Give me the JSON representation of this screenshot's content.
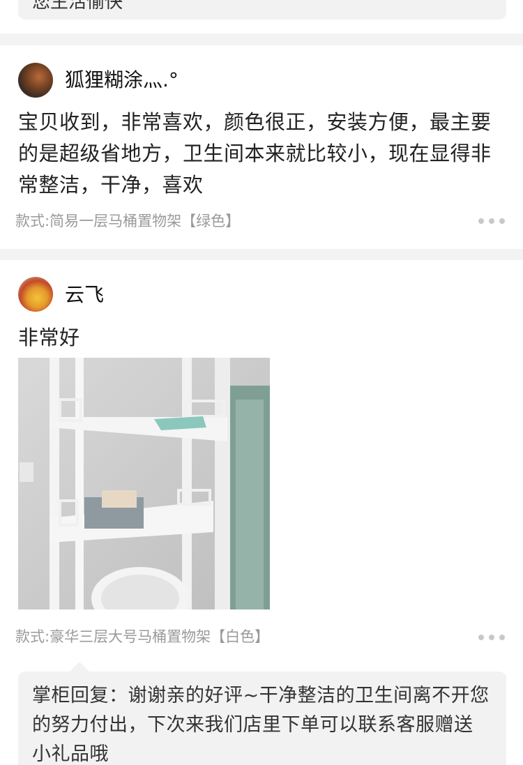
{
  "previous_reply": {
    "text": "您生活愉快"
  },
  "reviews": [
    {
      "username": "狐狸糊涂灬.°",
      "text": "宝贝收到，非常喜欢，颜色很正，安装方便，最主要的是超级省地方，卫生间本来就比较小，现在显得非常整洁，干净，喜欢",
      "spec": "款式:简易一层马桶置物架【绿色】",
      "avatar_icon": "user-avatar",
      "more_icon": "more-dots-icon"
    },
    {
      "username": "云飞",
      "text": "非常好",
      "spec": "款式:豪华三层大号马桶置物架【白色】",
      "avatar_icon": "user-avatar",
      "more_icon": "more-dots-icon",
      "photo_icon": "review-photo",
      "reply": "掌柜回复：谢谢亲的好评~干净整洁的卫生间离不开您的努力付出，下次来我们店里下单可以联系客服赠送小礼品哦"
    }
  ],
  "colors": {
    "divider": "#f3f3f3",
    "reply_bg": "#f2f2f2",
    "spec_text": "#9a9a9a",
    "dots": "#c8c8c8"
  }
}
